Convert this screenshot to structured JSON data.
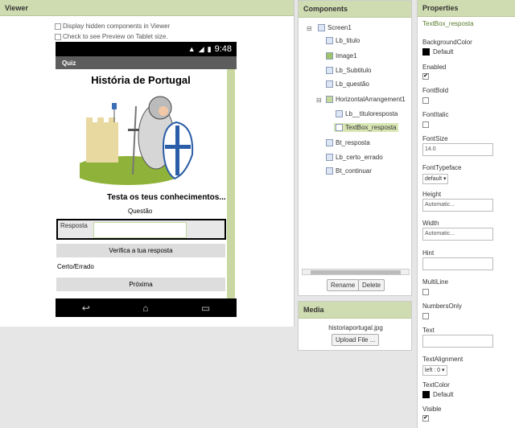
{
  "viewer": {
    "header": "Viewer",
    "display_hidden": "Display hidden components in Viewer",
    "tablet_preview": "Check to see Preview on Tablet size."
  },
  "phone": {
    "time": "9:48",
    "app_title": "Quiz",
    "lb_titulo": "História de Portugal",
    "lb_subtitulo": "Testa os teus conhecimentos...",
    "lb_questao": "Questão",
    "lb_resposta": "Resposta",
    "bt_resposta": "Verifica a tua resposta",
    "lb_certo_errado": "Certo/Errado",
    "bt_continuar": "Próxima"
  },
  "components": {
    "header": "Components",
    "tree": [
      {
        "label": "Screen1",
        "level": 0
      },
      {
        "label": "Lb_titulo",
        "level": 1
      },
      {
        "label": "Image1",
        "level": 1
      },
      {
        "label": "Lb_Subtitulo",
        "level": 1
      },
      {
        "label": "Lb_questão",
        "level": 1
      },
      {
        "label": "HorizontalArrangement1",
        "level": 1
      },
      {
        "label": "Lb__tituloresposta",
        "level": 2
      },
      {
        "label": "TextBox_resposta",
        "level": 2
      },
      {
        "label": "Bt_resposta",
        "level": 1
      },
      {
        "label": "Lb_certo_errado",
        "level": 1
      },
      {
        "label": "Bt_continuar",
        "level": 1
      }
    ],
    "rename_label": "Rename",
    "delete_label": "Delete"
  },
  "media": {
    "header": "Media",
    "file": "historiaportugal.jpg",
    "upload_label": "Upload File ..."
  },
  "properties": {
    "header": "Properties",
    "selected": "TextBox_resposta",
    "background_color_label": "BackgroundColor",
    "background_color_value": "Default",
    "enabled_label": "Enabled",
    "fontbold_label": "FontBold",
    "fontitalic_label": "FontItalic",
    "fontsize_label": "FontSize",
    "fontsize_value": "14.0",
    "fonttypeface_label": "FontTypeface",
    "fonttypeface_value": "default ▾",
    "height_label": "Height",
    "height_value": "Automatic...",
    "width_label": "Width",
    "width_value": "Automatic...",
    "hint_label": "Hint",
    "multiline_label": "MultiLine",
    "numbersonly_label": "NumbersOnly",
    "text_label": "Text",
    "textalignment_label": "TextAlignment",
    "textalignment_value": "left : 0 ▾",
    "textcolor_label": "TextColor",
    "textcolor_value": "Default",
    "visible_label": "Visible"
  },
  "colors": {
    "header_bg": "#cfdbb0",
    "selection": "#d8e6b4"
  }
}
